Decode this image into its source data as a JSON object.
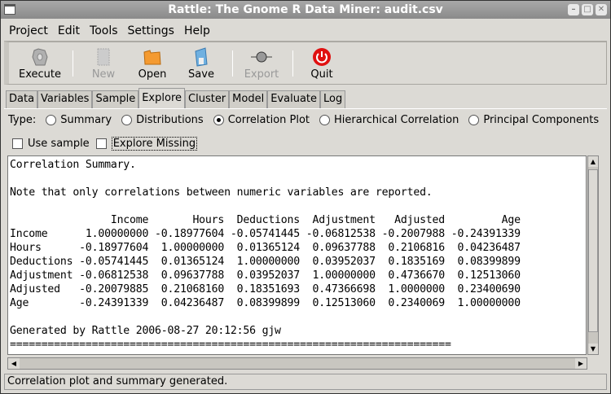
{
  "window": {
    "title": "Rattle: The Gnome R Data Miner: audit.csv"
  },
  "menu": [
    "Project",
    "Edit",
    "Tools",
    "Settings",
    "Help"
  ],
  "toolbar": {
    "execute": "Execute",
    "new": "New",
    "open": "Open",
    "save": "Save",
    "export": "Export",
    "quit": "Quit"
  },
  "tabs": [
    "Data",
    "Variables",
    "Sample",
    "Explore",
    "Cluster",
    "Model",
    "Evaluate",
    "Log"
  ],
  "active_tab": "Explore",
  "type_label": "Type:",
  "types": [
    "Summary",
    "Distributions",
    "Correlation Plot",
    "Hierarchical Correlation",
    "Principal Components"
  ],
  "selected_type": "Correlation Plot",
  "use_sample": {
    "label": "Use sample",
    "checked": false
  },
  "explore_missing": {
    "label": "Explore Missing",
    "checked": false
  },
  "output": {
    "lines": [
      "Correlation Summary.",
      "",
      "Note that only correlations between numeric variables are reported.",
      "",
      "                Income       Hours  Deductions  Adjustment   Adjusted         Age",
      "Income      1.00000000 -0.18977604 -0.05741445 -0.06812538 -0.2007988 -0.24391339",
      "Hours      -0.18977604  1.00000000  0.01365124  0.09637788  0.2106816  0.04236487",
      "Deductions -0.05741445  0.01365124  1.00000000  0.03952037  0.1835169  0.08399899",
      "Adjustment -0.06812538  0.09637788  0.03952037  1.00000000  0.4736670  0.12513060",
      "Adjusted   -0.20079885  0.21068160  0.18351693  0.47366698  1.0000000  0.23400690",
      "Age        -0.24391339  0.04236487  0.08399899  0.12513060  0.2340069  1.00000000",
      "",
      "Generated by Rattle 2006-08-27 20:12:56 gjw",
      "======================================================================"
    ]
  },
  "status": "Correlation plot and summary generated."
}
